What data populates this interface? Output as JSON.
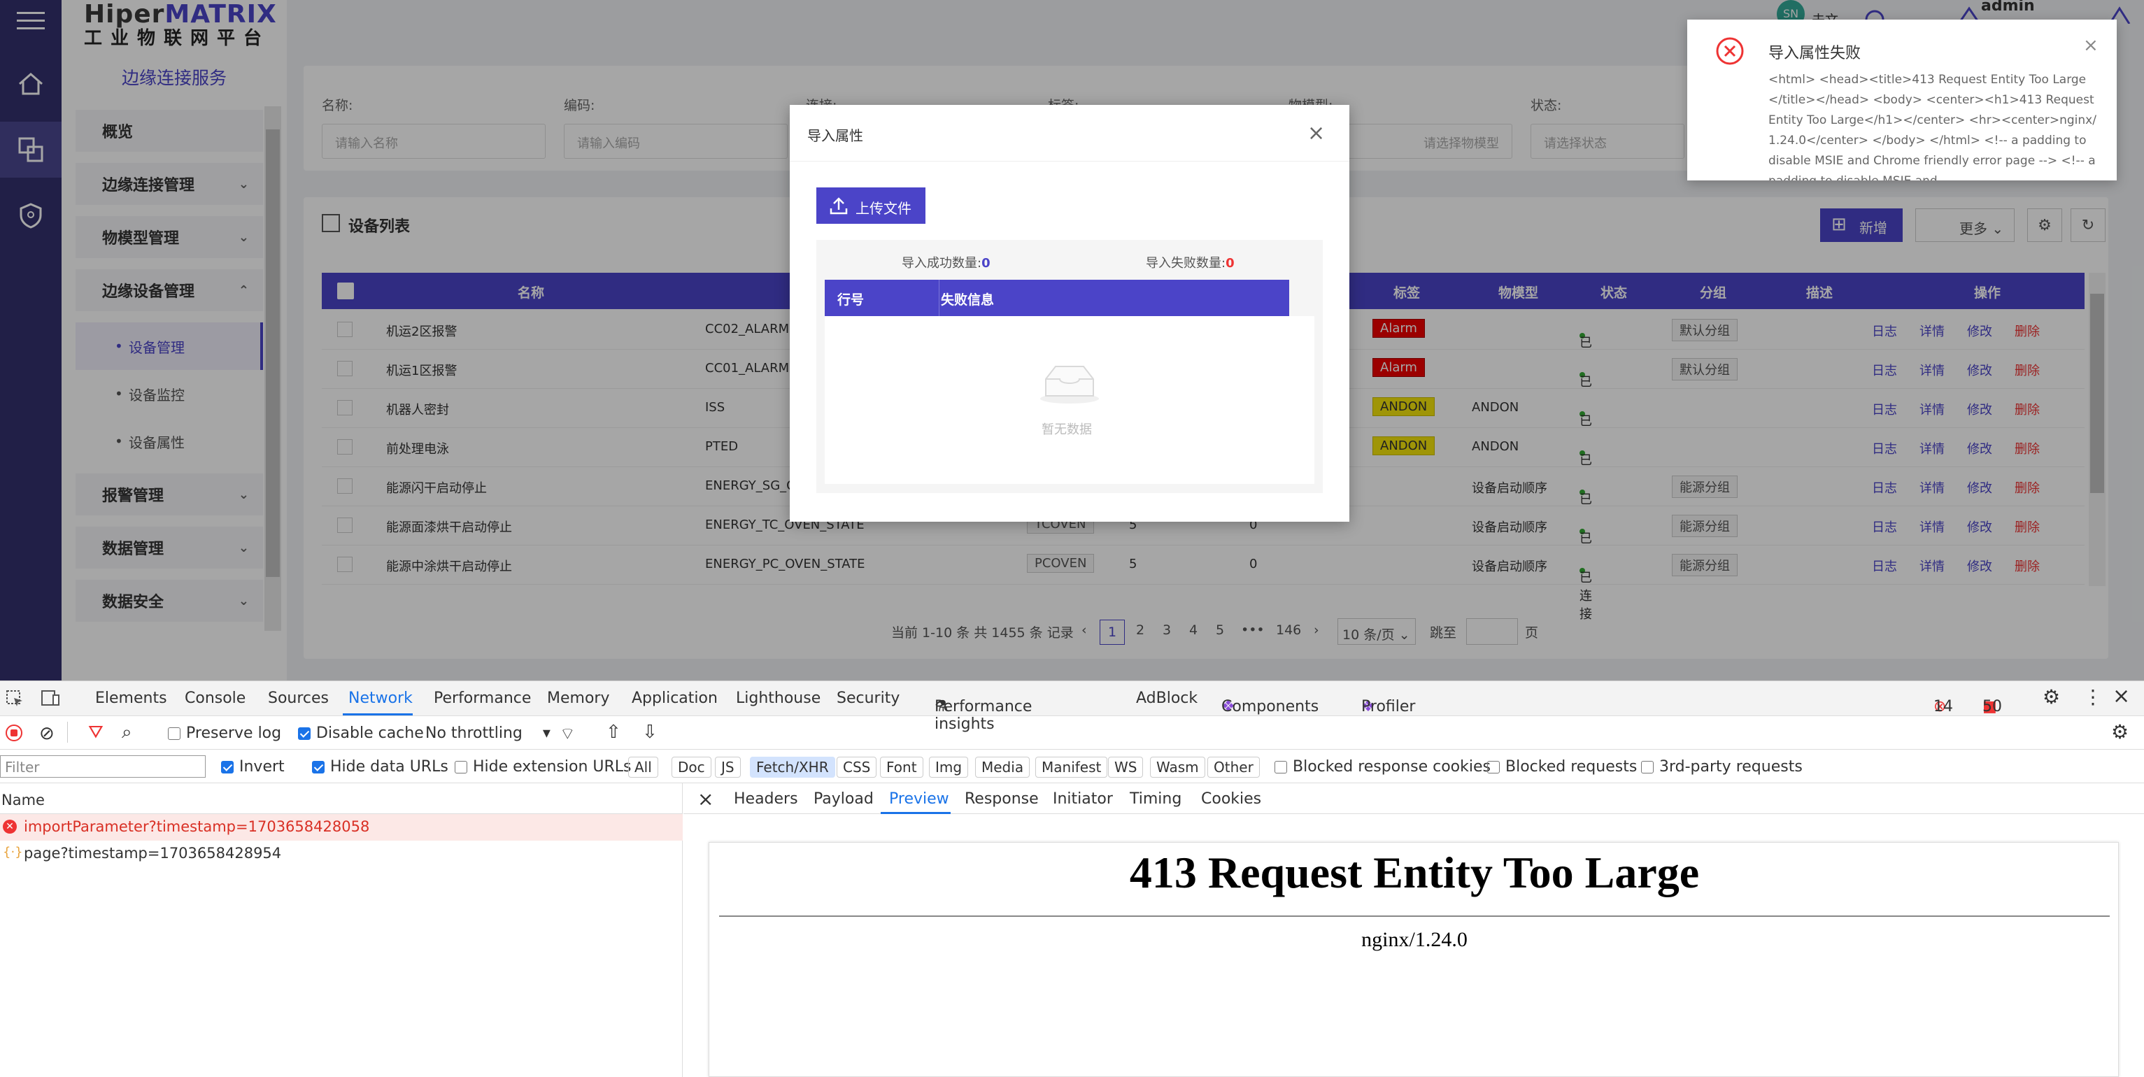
{
  "logo": {
    "brand_a": "Hiper",
    "brand_b": "MATRIX",
    "subtitle": "工业物联网平台"
  },
  "header": {
    "user": "admin",
    "avatar": "SN",
    "user_extra": "未文"
  },
  "sidebar": {
    "title": "边缘连接服务",
    "items": [
      {
        "label": "概览"
      },
      {
        "label": "边缘连接管理"
      },
      {
        "label": "物模型管理"
      },
      {
        "label": "边缘设备管理"
      }
    ],
    "subitems": [
      {
        "label": "设备管理"
      },
      {
        "label": "设备监控"
      },
      {
        "label": "设备属性"
      }
    ],
    "items2": [
      {
        "label": "报警管理"
      },
      {
        "label": "数据管理"
      },
      {
        "label": "数据安全"
      }
    ]
  },
  "filters": {
    "name_label": "名称:",
    "name_ph": "请输入名称",
    "code_label": "编码:",
    "code_ph": "请输入编码",
    "conn_label": "连接:",
    "tag_label": "标签:",
    "model_label": "物模型:",
    "model_ph": "请选择物模型",
    "status_label": "状态:",
    "status_ph": "请选择状态"
  },
  "list": {
    "title": "设备列表",
    "add": "新增",
    "more": "更多"
  },
  "table": {
    "headers": {
      "name": "名称",
      "tag": "标签",
      "model": "物模型",
      "status": "状态",
      "group": "分组",
      "desc": "描述",
      "ops": "操作"
    },
    "rows": [
      {
        "name": "机运2区报警",
        "code": "CC02_ALARM",
        "conn": "",
        "c1": "",
        "c2": "",
        "tag": "Alarm",
        "tagType": "red",
        "model": "",
        "status": "已连接",
        "group": "默认分组"
      },
      {
        "name": "机运1区报警",
        "code": "CC01_ALARM",
        "conn": "",
        "c1": "",
        "c2": "",
        "tag": "Alarm",
        "tagType": "red",
        "model": "",
        "status": "已连接",
        "group": "默认分组"
      },
      {
        "name": "机器人密封",
        "code": "ISS",
        "conn": "",
        "c1": "",
        "c2": "",
        "tag": "ANDON",
        "tagType": "yellow",
        "model": "ANDON",
        "status": "已连接",
        "group": ""
      },
      {
        "name": "前处理电泳",
        "code": "PTED",
        "conn": "",
        "c1": "",
        "c2": "",
        "tag": "ANDON",
        "tagType": "yellow",
        "model": "ANDON",
        "status": "已连接",
        "group": ""
      },
      {
        "name": "能源闪干启动停止",
        "code": "ENERGY_SG_O",
        "conn": "",
        "c1": "",
        "c2": "",
        "tag": "",
        "tagType": "",
        "model": "设备启动顺序",
        "status": "已连接",
        "group": "能源分组"
      },
      {
        "name": "能源面漆烘干启动停止",
        "code": "ENERGY_TC_OVEN_STATE",
        "conn": "TCOVEN",
        "c1": "5",
        "c2": "0",
        "tag": "",
        "tagType": "",
        "model": "设备启动顺序",
        "status": "已连接",
        "group": "能源分组"
      },
      {
        "name": "能源中涂烘干启动停止",
        "code": "ENERGY_PC_OVEN_STATE",
        "conn": "PCOVEN",
        "c1": "5",
        "c2": "0",
        "tag": "",
        "tagType": "",
        "model": "设备启动顺序",
        "status": "已连接",
        "group": "能源分组"
      }
    ],
    "ops": {
      "log": "日志",
      "detail": "详情",
      "edit": "修改",
      "del": "删除"
    }
  },
  "pagination": {
    "summary": "当前 1-10 条 共 1455 条 记录",
    "pages": [
      "1",
      "2",
      "3",
      "4",
      "5"
    ],
    "ellipsis": "•••",
    "last": "146",
    "size": "10 条/页",
    "jump": "跳至",
    "page_unit": "页"
  },
  "dialog": {
    "title": "导入属性",
    "upload": "上传文件",
    "success_label": "导入成功数量:",
    "success_count": "0",
    "fail_label": "导入失败数量:",
    "fail_count": "0",
    "col_row": "行号",
    "col_msg": "失败信息",
    "empty": "暂无数据"
  },
  "toast": {
    "title": "导入属性失败",
    "body": "<html> <head><title>413 Request Entity Too Large</title></head> <body> <center><h1>413 Request Entity Too Large</h1></center> <hr><center>nginx/1.24.0</center> </body> </html> <!-- a padding to disable MSIE and Chrome friendly error page --> <!-- a padding to disable MSIE and"
  },
  "devtools": {
    "tabs": [
      "Elements",
      "Console",
      "Sources",
      "Network",
      "Performance",
      "Memory",
      "Application",
      "Lighthouse",
      "Security",
      "Performance insights",
      "AdBlock",
      "Components",
      "Profiler"
    ],
    "errors": "14",
    "warnings": "50",
    "preserve_log": "Preserve log",
    "disable_cache": "Disable cache",
    "throttling": "No throttling",
    "filter_ph": "Filter",
    "invert": "Invert",
    "hide_data_urls": "Hide data URLs",
    "hide_ext_urls": "Hide extension URLs",
    "types": [
      "All",
      "Doc",
      "JS",
      "Fetch/XHR",
      "CSS",
      "Font",
      "Img",
      "Media",
      "Manifest",
      "WS",
      "Wasm",
      "Other"
    ],
    "blocked_cookies": "Blocked response cookies",
    "blocked_requests": "Blocked requests",
    "third_party": "3rd-party requests",
    "name_col": "Name",
    "requests": [
      {
        "name": "importParameter?timestamp=1703658428058"
      },
      {
        "name": "page?timestamp=1703658428954"
      }
    ],
    "detail_tabs": [
      "Headers",
      "Payload",
      "Preview",
      "Response",
      "Initiator",
      "Timing",
      "Cookies"
    ],
    "preview_title": "413 Request Entity Too Large",
    "preview_server": "nginx/1.24.0"
  }
}
